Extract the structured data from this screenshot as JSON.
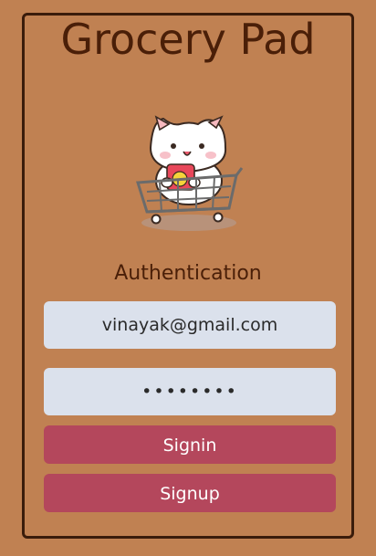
{
  "app": {
    "title": "Grocery Pad"
  },
  "auth": {
    "heading": "Authentication",
    "email_value": "vinayak@gmail.com",
    "password_value": "••••••••",
    "signin_label": "Signin",
    "signup_label": "Signup"
  },
  "mascot": {
    "icon": "cat-in-shopping-cart-icon"
  },
  "colors": {
    "background": "#c08152",
    "border": "#3a1c0b",
    "title_text": "#4a1f08",
    "field_bg": "#dbe1ec",
    "button_bg": "#b4475c",
    "button_text": "#ffffff"
  }
}
